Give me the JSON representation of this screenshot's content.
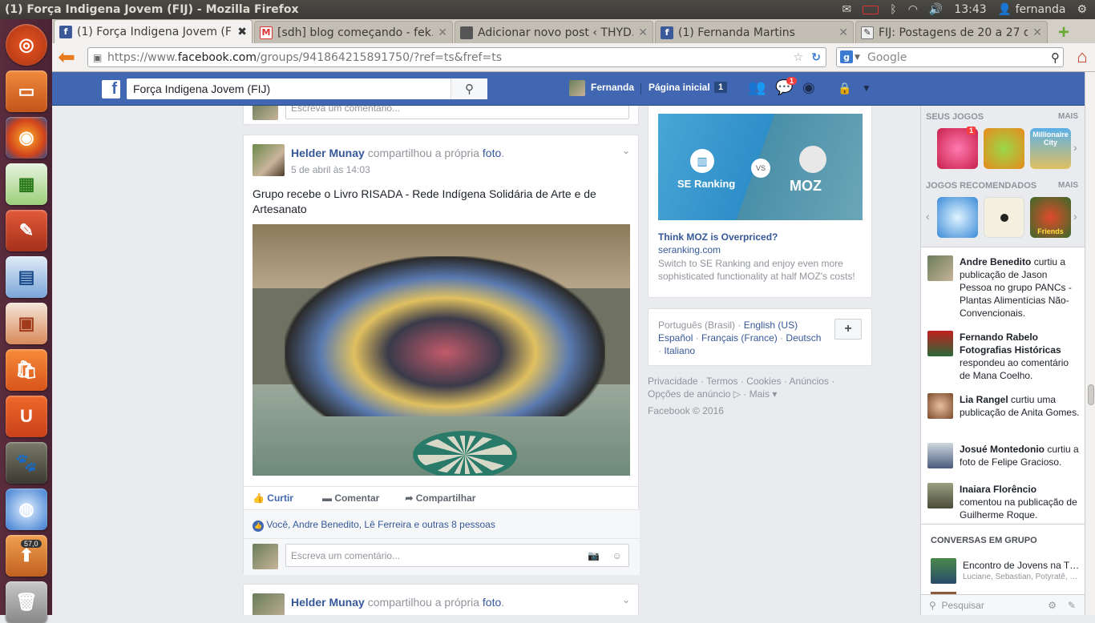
{
  "os": {
    "window_title": "(1) Força Indigena Jovem (FIJ) - Mozilla Firefox",
    "clock": "13:43",
    "user": "fernanda",
    "launcher_badge": "57,0"
  },
  "browser": {
    "tabs": [
      {
        "label": "(1) Força Indigena Jovem (FIJ)",
        "icon": "facebook-icon",
        "active": true
      },
      {
        "label": "[sdh] blog começando - fek…",
        "icon": "gmail-icon",
        "active": false
      },
      {
        "label": "Adicionar novo post ‹ THYD…",
        "icon": "wordpress-icon",
        "active": false
      },
      {
        "label": "(1) Fernanda Martins",
        "icon": "facebook-icon",
        "active": false
      },
      {
        "label": "FIJ: Postagens de 20 a 27 de…",
        "icon": "blog-icon",
        "active": false
      }
    ],
    "url_prefix": "https://www.",
    "url_domain": "facebook.com",
    "url_suffix": "/groups/941864215891750/?ref=ts&fref=ts",
    "search_placeholder": "Google"
  },
  "fb": {
    "search_value": "Força Indigena Jovem (FIJ)",
    "user_name": "Fernanda",
    "home_label": "Página inicial",
    "home_count": "1",
    "messages_count": "1",
    "comment_placeholder": "Escreva um comentário...",
    "post": {
      "author": "Helder Munay",
      "shared_text": "compartilhou a própria",
      "shared_link": "foto",
      "date": "5 de abril às 14:03",
      "text": "Grupo recebe o Livro RISADA - Rede Indígena Solidária de Arte e de Artesanato",
      "like_label": "Curtir",
      "comment_label": "Comentar",
      "share_label": "Compartilhar",
      "likes_text": "Você, Andre Benedito, Lê Ferreira e outras 8 pessoas"
    },
    "next_post": {
      "author": "Helder Munay",
      "shared_text": "compartilhou a própria",
      "shared_link": "foto"
    },
    "ad": {
      "left_brand": "SE Ranking",
      "vs": "VS",
      "right_brand": "MOZ",
      "title": "Think MOZ is Overpriced?",
      "domain": "seranking.com",
      "desc": "Switch to SE Ranking and enjoy even more sophisticated functionality at half MOZ's costs!"
    },
    "languages": {
      "current": "Português (Brasil)",
      "others": [
        "English (US)",
        "Español",
        "Français (France)",
        "Deutsch",
        "Italiano"
      ],
      "add_label": "+"
    },
    "footer": {
      "links": [
        "Privacidade",
        "Termos",
        "Cookies",
        "Anúncios",
        "Opções de anúncio",
        "Mais"
      ],
      "copyright": "Facebook © 2016"
    },
    "sidebar": {
      "games_header": "Seus jogos",
      "games_more": "MAIS",
      "games_badge": "1",
      "recommended_header": "Jogos recomendados",
      "recommended_more": "MAIS",
      "game_labels": [
        "Millionaire City",
        "Friends"
      ],
      "ticker": [
        {
          "name": "Andre Benedito",
          "text": "curtiu a publicação de Jason Pessoa no grupo PANCs - Plantas Alimentícias Não-Convencionais."
        },
        {
          "name": "Fernando Rabelo Fotografias Históricas",
          "text": "respondeu ao comentário de Mana Coelho."
        },
        {
          "name": "Lia Rangel",
          "text": "curtiu uma publicação de Anita Gomes."
        },
        {
          "name": "Josué Montedonio",
          "text": "curtiu a foto de Felipe Gracioso."
        },
        {
          "name": "Inaiara Florêncio",
          "text": "comentou na publicação de Guilherme Roque."
        }
      ],
      "group_chats_header": "Conversas em grupo",
      "group_chat": {
        "title": "Encontro de Jovens na T…",
        "members": "Luciane, Sebastian, Potyratê, …"
      },
      "search_placeholder": "Pesquisar"
    }
  },
  "colors": {
    "fb_blue": "#4267b2",
    "link": "#365899",
    "ubuntu_bar": "#3c3b37",
    "launcher": "#4a2333"
  }
}
